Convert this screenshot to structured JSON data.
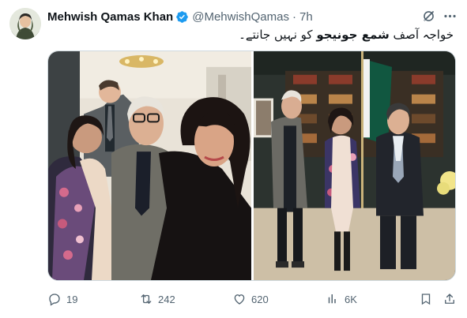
{
  "author": {
    "name": "Mehwish Qamas Khan",
    "handle": "@MehwishQamas",
    "separator": "·",
    "time": "7h"
  },
  "tweet": {
    "text_before": "خواجہ آصف ",
    "text_bold": "شمع جونیجو",
    "text_after": " کو نہیں جانتے۔"
  },
  "actions": {
    "replies": "19",
    "reposts": "242",
    "likes": "620",
    "views": "6K"
  },
  "icons": {
    "verified": "verified-badge-icon",
    "grok": "grok-icon",
    "more": "more-icon",
    "reply": "reply-icon",
    "repost": "repost-icon",
    "like": "heart-icon",
    "views": "views-icon",
    "bookmark": "bookmark-icon",
    "share": "share-icon"
  },
  "colors": {
    "text": "#0f1419",
    "secondary": "#536471",
    "verified": "#1d9bf0"
  }
}
